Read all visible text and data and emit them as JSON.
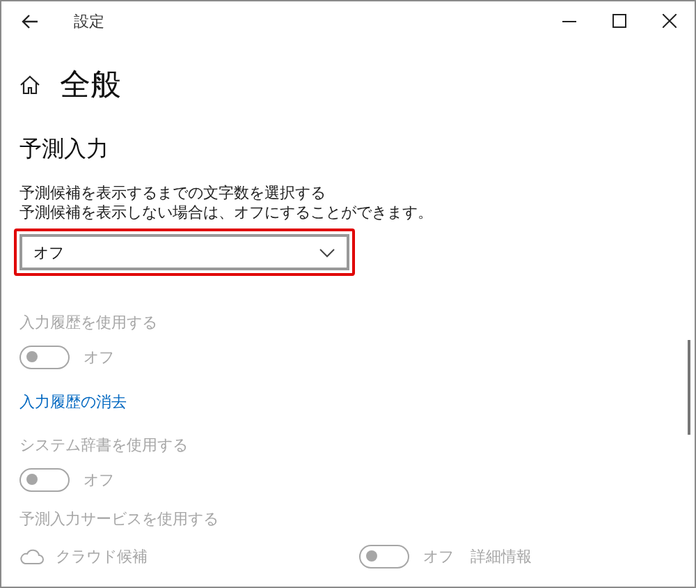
{
  "window": {
    "title": "設定"
  },
  "page": {
    "title": "全般"
  },
  "section": {
    "title": "予測入力",
    "description": [
      "予測候補を表示するまでの文字数を選択する",
      "予測候補を表示しない場合は、オフにすることができます。"
    ]
  },
  "dropdown": {
    "value": "オフ",
    "highlighted": true
  },
  "settings": [
    {
      "kind": "toggle",
      "label": "入力履歴を使用する",
      "on": false,
      "state_text": "オフ",
      "disabled": true
    },
    {
      "kind": "link",
      "label": "入力履歴の消去"
    },
    {
      "kind": "toggle",
      "label": "システム辞書を使用する",
      "on": false,
      "state_text": "オフ",
      "disabled": true
    },
    {
      "kind": "service",
      "label": "予測入力サービスを使用する",
      "item": "クラウド候補",
      "on": false,
      "state_text": "オフ",
      "link": "詳細情報",
      "disabled": true
    }
  ]
}
